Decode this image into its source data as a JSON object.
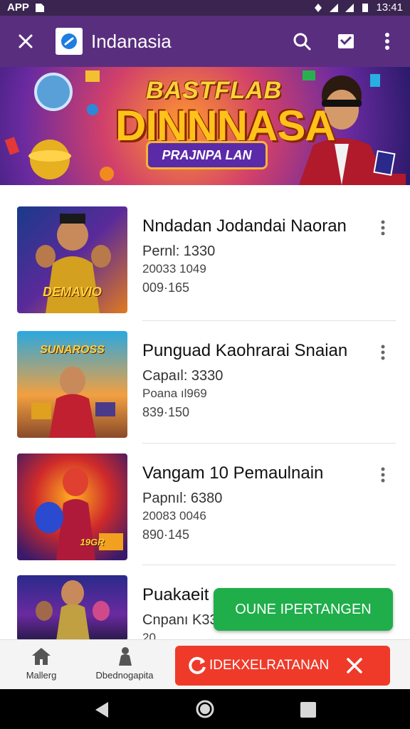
{
  "status_bar": {
    "left_text": "APP",
    "time": "13:41"
  },
  "app_bar": {
    "title": "Indanasia"
  },
  "banner": {
    "line1": "BASTFLAB",
    "line2": "DINNNASA",
    "pill": "PRAJNPA LAN"
  },
  "items": [
    {
      "name": "Nndadan Jodandai Naoran",
      "meta1": "Pernl: 1330",
      "meta2": "20033 1049",
      "meta3": "009·165",
      "thumb_text": "DEMAVIO"
    },
    {
      "name": "Punguad Kaohrarai Snaian",
      "meta1": "Capaıl: 3330",
      "meta2": "Poana ıl969",
      "meta3": "839·150",
      "thumb_text": "SUNAROSS"
    },
    {
      "name": "Vangam 10 Pemaulnain",
      "meta1": "Papnıl: 6380",
      "meta2": "20083 0046",
      "meta3": "890·145",
      "thumb_text": "19GR"
    },
    {
      "name": "Puakaeit",
      "meta1": "Cnpanı K330",
      "meta2": "20",
      "meta3": "",
      "thumb_text": ""
    }
  ],
  "fab": {
    "label": "OUNE IPERTANGEN"
  },
  "bottom_nav": {
    "tab1": "Mallerg",
    "tab2": "Dbednogapita",
    "alert_label": "IDEKXELRATANAN"
  },
  "colors": {
    "app_bar": "#5a2e7f",
    "fab": "#1fae4a",
    "alert": "#ef3a2a"
  }
}
